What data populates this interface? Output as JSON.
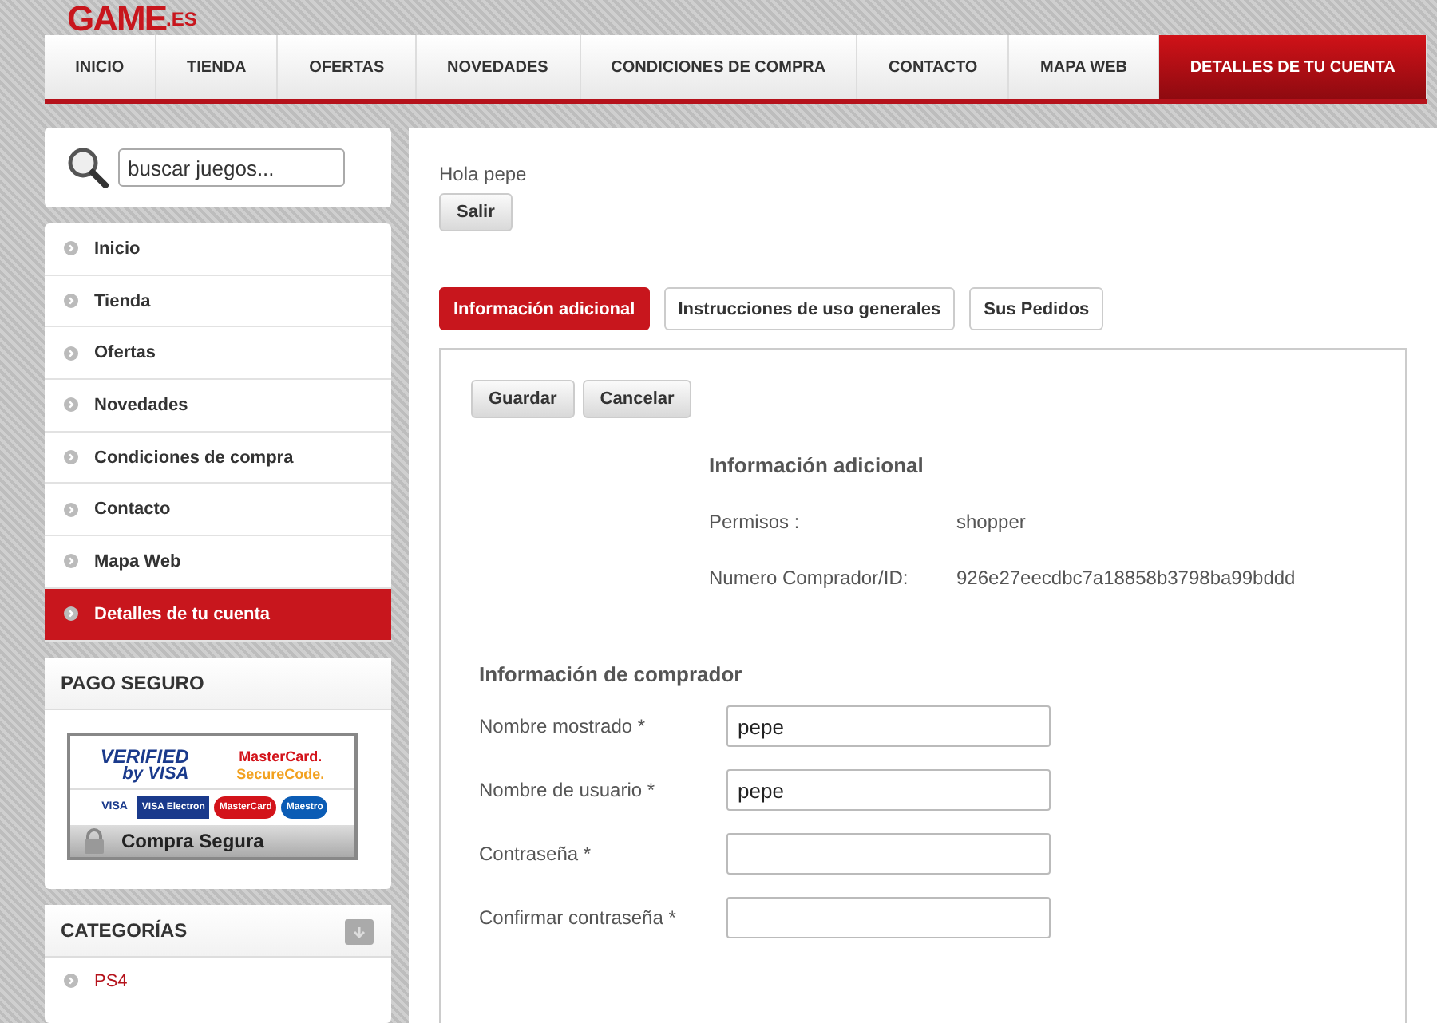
{
  "logo": {
    "name": "GAME",
    "suffix": ".ES"
  },
  "nav": [
    {
      "label": "INICIO",
      "selected": false
    },
    {
      "label": "TIENDA",
      "selected": false
    },
    {
      "label": "OFERTAS",
      "selected": false
    },
    {
      "label": "NOVEDADES",
      "selected": false
    },
    {
      "label": "CONDICIONES DE COMPRA",
      "selected": false
    },
    {
      "label": "CONTACTO",
      "selected": false
    },
    {
      "label": "MAPA WEB",
      "selected": false
    },
    {
      "label": "DETALLES DE TU CUENTA",
      "selected": true
    }
  ],
  "search": {
    "placeholder": "buscar juegos..."
  },
  "sidebar_menu": [
    {
      "label": "Inicio",
      "selected": false
    },
    {
      "label": "Tienda",
      "selected": false
    },
    {
      "label": "Ofertas",
      "selected": false
    },
    {
      "label": "Novedades",
      "selected": false
    },
    {
      "label": "Condiciones de compra",
      "selected": false
    },
    {
      "label": "Contacto",
      "selected": false
    },
    {
      "label": "Mapa Web",
      "selected": false
    },
    {
      "label": "Detalles de tu cuenta",
      "selected": true
    }
  ],
  "secure_payment": {
    "title": "PAGO SEGURO",
    "badge": {
      "verified": "VERIFIED",
      "by_visa": "by VISA",
      "mastercard": "MasterCard.",
      "securecode": "SecureCode.",
      "cards": [
        "VISA",
        "VISA Electron",
        "MasterCard",
        "Maestro"
      ],
      "footer": "Compra Segura"
    }
  },
  "categories": {
    "title": "CATEGORÍAS",
    "items": [
      {
        "label": "PS4"
      }
    ]
  },
  "greeting": "Hola pepe",
  "logout_button": "Salir",
  "tabs": [
    {
      "label": "Información adicional",
      "selected": true
    },
    {
      "label": "Instrucciones de uso generales",
      "selected": false
    },
    {
      "label": "Sus Pedidos",
      "selected": false
    }
  ],
  "actions": [
    "Guardar",
    "Cancelar"
  ],
  "additional_info": {
    "title": "Información adicional",
    "rows": [
      {
        "label": "Permisos :",
        "value": "shopper"
      },
      {
        "label": "Numero Comprador/ID:",
        "value": "926e27eecdbc7a18858b3798ba99bddd"
      }
    ]
  },
  "buyer_info": {
    "title": "Información de comprador",
    "fields": [
      {
        "label": "Nombre mostrado *",
        "value": "pepe"
      },
      {
        "label": "Nombre de usuario *",
        "value": "pepe"
      },
      {
        "label": "Contraseña *"
      },
      {
        "label": "Confirmar contraseña *"
      }
    ]
  }
}
